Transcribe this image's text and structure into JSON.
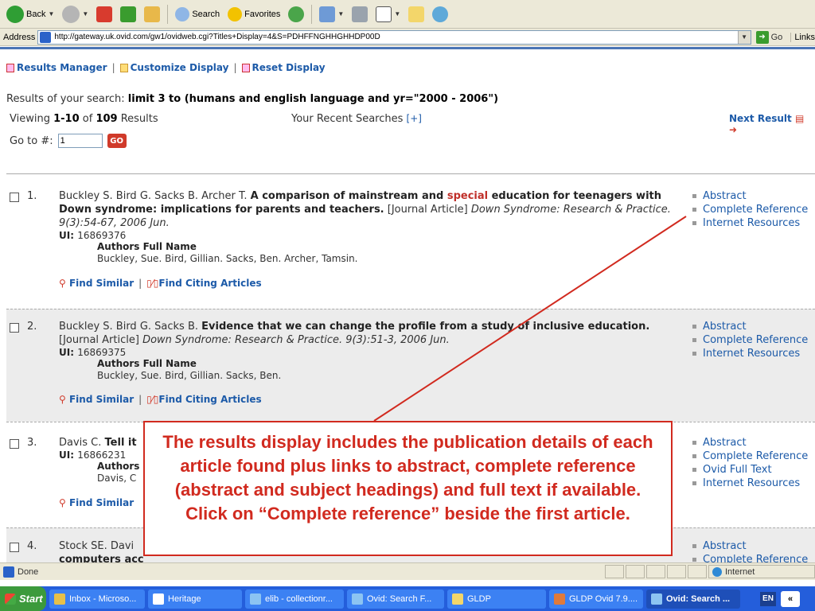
{
  "toolbar": {
    "back_label": "Back",
    "search_label": "Search",
    "favorites_label": "Favorites"
  },
  "address": {
    "label": "Address",
    "url": "http://gateway.uk.ovid.com/gw1/ovidweb.cgi?Titles+Display=4&S=PDHFFNGHHGHHDP00D",
    "go_label": "Go",
    "links_label": "Links"
  },
  "results_manager": {
    "results_manager": "Results Manager",
    "customize_display": "Customize Display",
    "reset_display": "Reset Display"
  },
  "search": {
    "prefix": "Results of your search: ",
    "query": "limit 3 to (humans and english language and yr=\"2000 - 2006\")",
    "viewing_prefix": "Viewing ",
    "viewing_range": "1-10",
    "viewing_of": " of ",
    "viewing_total": "109",
    "viewing_suffix": " Results",
    "recent_label": "Your Recent Searches ",
    "recent_toggle": "[+]",
    "next_result": "Next Result",
    "goto_label": "Go to #:",
    "goto_value": "1",
    "goto_button": "GO"
  },
  "results": [
    {
      "number": "1.",
      "authors": "Buckley S. Bird G. Sacks B. Archer T. ",
      "title_a": "A comparison of mainstream and ",
      "title_hl": "special",
      "title_b": " education for teenagers with Down syndrome: implications for parents and teachers.",
      "type": " [Journal Article] ",
      "source": "Down Syndrome: Research & Practice. 9(3):54-67, 2006 Jun.",
      "ui_label": "UI: ",
      "ui": "16869376",
      "af_label": "Authors Full Name",
      "af": "Buckley, Sue. Bird, Gillian. Sacks, Ben. Archer, Tamsin.",
      "find_similar": "Find Similar",
      "find_citing": "Find Citing Articles",
      "links": [
        "Abstract",
        "Complete Reference",
        "Internet Resources"
      ]
    },
    {
      "number": "2.",
      "authors": "Buckley S. Bird G. Sacks B. ",
      "title_a": "Evidence that we can change the profile from a study of inclusive education.",
      "type": " [Journal Article] ",
      "source": "Down Syndrome: Research & Practice. 9(3):51-3, 2006 Jun.",
      "ui_label": "UI: ",
      "ui": "16869375",
      "af_label": "Authors Full Name",
      "af": "Buckley, Sue. Bird, Gillian. Sacks, Ben.",
      "find_similar": "Find Similar",
      "find_citing": "Find Citing Articles",
      "links": [
        "Abstract",
        "Complete Reference",
        "Internet Resources"
      ]
    },
    {
      "number": "3.",
      "authors": "Davis C. ",
      "title_a": "Tell it",
      "ui_label": "UI: ",
      "ui": "16866231",
      "af_label": "Authors",
      "af": "Davis, C",
      "find_similar": "Find Similar",
      "links": [
        "Abstract",
        "Complete Reference",
        "Ovid Full Text",
        "Internet Resources"
      ]
    },
    {
      "number": "4.",
      "authors": "Stock SE. Davi",
      "title_a": "computers acc",
      "links": [
        "Abstract",
        "Complete Reference"
      ]
    }
  ],
  "callout": {
    "text": "The results display includes the publication details of each article found plus links to abstract, complete reference (abstract and subject headings) and full text if available.  Click on “Complete reference” beside the first article."
  },
  "status": {
    "text": "Done",
    "zone": "Internet"
  },
  "taskbar": {
    "start": "Start",
    "tasks": [
      "Inbox - Microso...",
      "Heritage",
      "elib - collectionr...",
      "Ovid: Search F...",
      "GLDP",
      "GLDP Ovid 7.9....",
      "Ovid: Search ..."
    ],
    "lang": "EN",
    "chevron": "«"
  },
  "colors": {
    "link_blue": "#1c5aa8",
    "highlight_red": "#c0302a",
    "callout_red": "#d12a1f"
  }
}
